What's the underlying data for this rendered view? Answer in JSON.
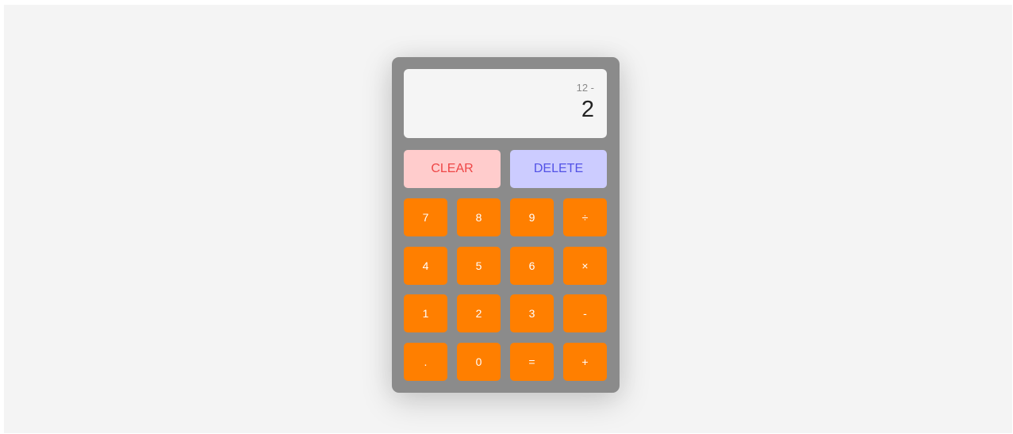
{
  "display": {
    "previous_operand": "12 -",
    "current_operand": "2"
  },
  "actions": {
    "clear_label": "CLEAR",
    "delete_label": "DELETE"
  },
  "keys": {
    "seven": "7",
    "eight": "8",
    "nine": "9",
    "divide": "÷",
    "four": "4",
    "five": "5",
    "six": "6",
    "multiply": "×",
    "one": "1",
    "two": "2",
    "three": "3",
    "subtract": "-",
    "decimal": ".",
    "zero": "0",
    "equals": "=",
    "add": "+"
  },
  "colors": {
    "page_background": "#f4f4f4",
    "calculator_body": "#8b8b8b",
    "key_orange": "#ff7f00",
    "clear_background": "#ffcccc",
    "clear_text": "#ee4646",
    "delete_background": "#ccccff",
    "delete_text": "#5252e6"
  }
}
